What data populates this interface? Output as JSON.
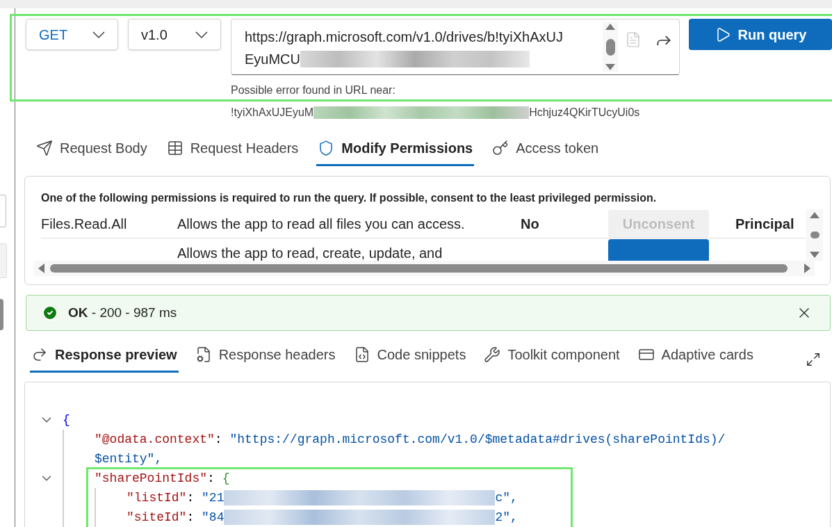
{
  "query": {
    "method": "GET",
    "version": "v1.0",
    "url_lines": [
      "https://graph.microsoft.com/v1.0/drives/b!tyiXhAxUJ",
      "EyuMCU"
    ],
    "run_label": "Run query"
  },
  "url_error": {
    "message": "Possible error found in URL near:",
    "near_start": "!tyiXhAxUJEyuM",
    "near_end": "Hchjuz4QKirTUcyUi0s"
  },
  "request_tabs": [
    {
      "label": "Request Body",
      "kind": "body",
      "selected": false
    },
    {
      "label": "Request Headers",
      "kind": "headers",
      "selected": false
    },
    {
      "label": "Modify Permissions",
      "kind": "permissions",
      "selected": true
    },
    {
      "label": "Access token",
      "kind": "token",
      "selected": false
    }
  ],
  "permissions": {
    "note": "One of the following permissions is required to run the query. If possible, consent to the least privileged permission.",
    "rows": [
      {
        "name": "Files.Read.All",
        "description": "Allows the app to read all files you can access.",
        "admin_consent": "No",
        "action": "Unconsent",
        "action_disabled": true,
        "type": "Principal"
      },
      {
        "description": "Allows the app to read, create, update, and",
        "action_disabled": false
      }
    ]
  },
  "status": {
    "kind": "success",
    "text": "**OK** - 200 - 987 ms"
  },
  "response_tabs": [
    {
      "label": "Response preview",
      "kind": "preview",
      "selected": true
    },
    {
      "label": "Response headers",
      "kind": "headers",
      "selected": false
    },
    {
      "label": "Code snippets",
      "kind": "snippets",
      "selected": false
    },
    {
      "label": "Toolkit component",
      "kind": "toolkit",
      "selected": false
    },
    {
      "label": "Adaptive cards",
      "kind": "cards",
      "selected": false
    }
  ],
  "response": {
    "open": "{",
    "expanded": true,
    "children": [
      {
        "key": "\"@odata.context\"",
        "colon": ":",
        "value_lines": [
          "\"https://graph.microsoft.com/v1.0/$metadata#drives(sharePointIds)/",
          "$entity\","
        ]
      },
      {
        "key": "\"sharePointIds\"",
        "colon": ":",
        "open": "{",
        "expanded": true,
        "children": [
          {
            "key": "\"listId\"",
            "colon": ":",
            "value_start": "\"21",
            "value_end": "c\","
          },
          {
            "key": "\"siteId\"",
            "colon": ":",
            "value_start": "\"84",
            "value_end": "2\","
          }
        ]
      }
    ]
  }
}
